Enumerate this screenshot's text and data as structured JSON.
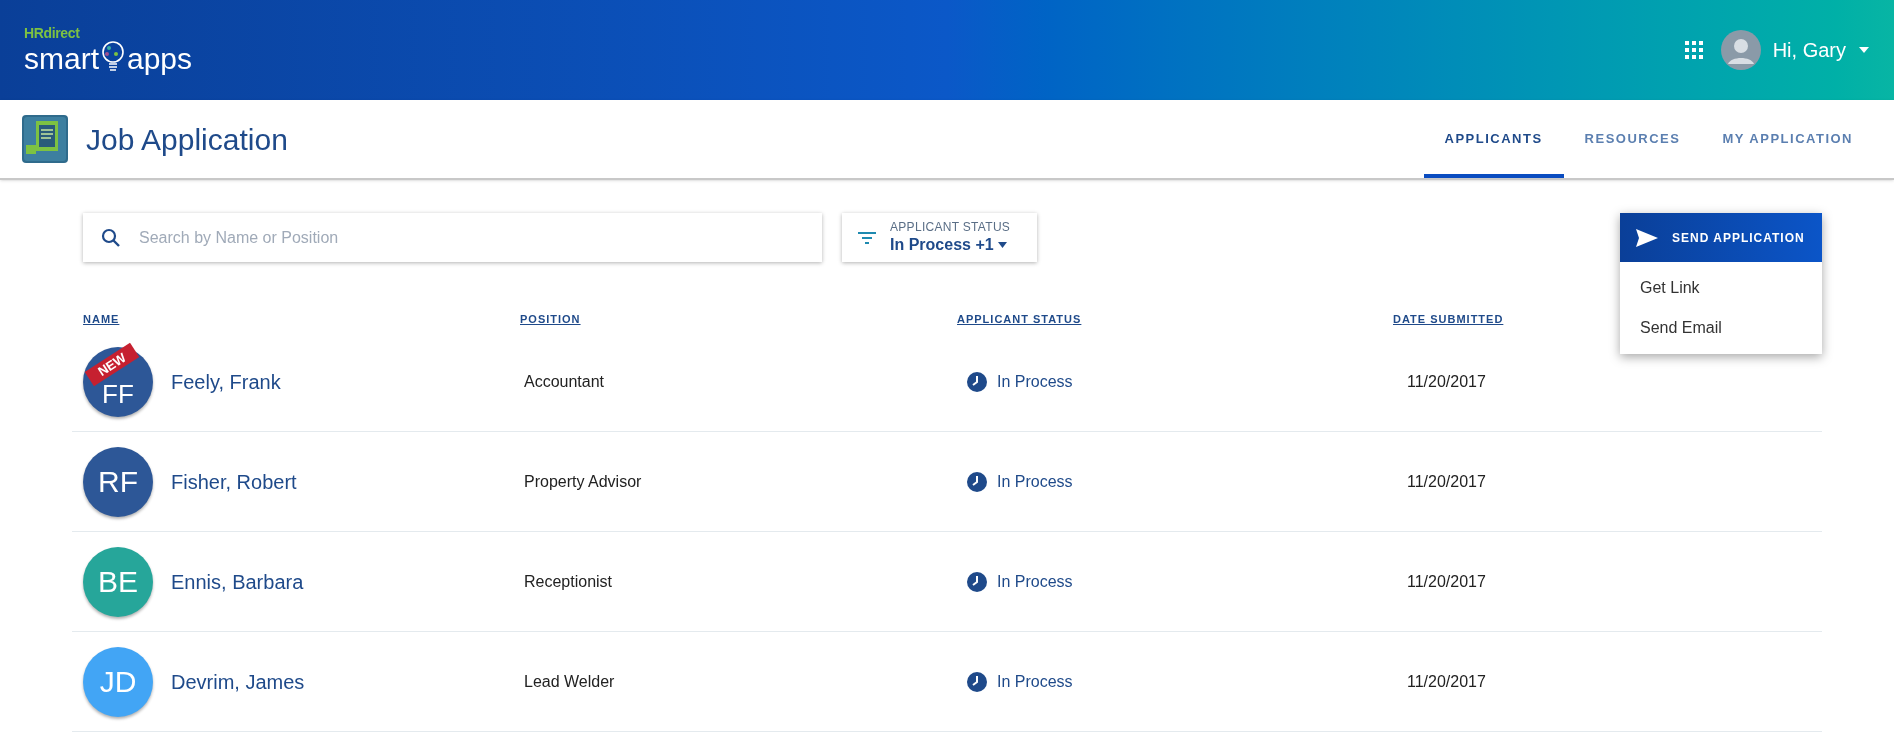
{
  "header": {
    "logo": {
      "brand": "HRdirect",
      "product_left": "smart",
      "product_right": "apps"
    },
    "user": {
      "greeting": "Hi, Gary"
    }
  },
  "app": {
    "title": "Job Application"
  },
  "tabs": [
    {
      "label": "APPLICANTS",
      "selected": true
    },
    {
      "label": "RESOURCES",
      "selected": false
    },
    {
      "label": "MY APPLICATION",
      "selected": false
    }
  ],
  "search": {
    "placeholder": "Search by Name or Position"
  },
  "status_filter": {
    "label": "APPLICANT STATUS",
    "value": "In Process +1"
  },
  "send_menu": {
    "button": "SEND APPLICATION",
    "expanded": true,
    "items": [
      "Get Link",
      "Send Email"
    ]
  },
  "table": {
    "columns": [
      "NAME",
      "POSITION",
      "APPLICANT STATUS",
      "DATE SUBMITTED"
    ],
    "rows": [
      {
        "initials": "FF",
        "badge": "NEW",
        "color": "#2d5797",
        "name": "Feely, Frank",
        "position": "Accountant",
        "status": "In Process",
        "date": "11/20/2017"
      },
      {
        "initials": "RF",
        "color": "#2d5797",
        "name": "Fisher, Robert",
        "position": "Property Advisor",
        "status": "In Process",
        "date": "11/20/2017"
      },
      {
        "initials": "BE",
        "color": "#26a69a",
        "name": "Ennis, Barbara",
        "position": "Receptionist",
        "status": "In Process",
        "date": "11/20/2017"
      },
      {
        "initials": "JD",
        "color": "#42a5f5",
        "name": "Devrim, James",
        "position": "Lead Welder",
        "status": "In Process",
        "date": "11/20/2017"
      }
    ]
  }
}
